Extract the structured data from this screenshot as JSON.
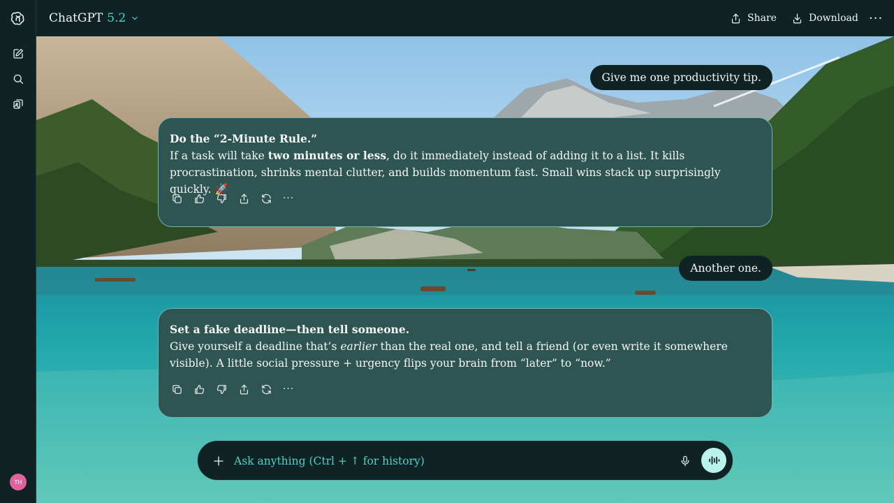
{
  "app": {
    "model_name": "ChatGPT",
    "model_version": "5.2"
  },
  "header": {
    "share_label": "Share",
    "download_label": "Download",
    "more_label": "···"
  },
  "sidebar": {
    "items": [
      {
        "icon": "openai-logo-icon"
      },
      {
        "icon": "new-chat-icon"
      },
      {
        "icon": "search-icon"
      },
      {
        "icon": "library-icon"
      }
    ],
    "avatar_initials": "TH"
  },
  "conversation": [
    {
      "role": "user",
      "text": "Give me one productivity tip."
    },
    {
      "role": "assistant",
      "title": "Do the “2-Minute Rule.”",
      "body_pre": "If a task will take ",
      "body_bold": "two minutes or less",
      "body_post": ", do it immediately instead of adding it to a list. It kills procrastination, shrinks mental clutter, and builds momentum fast. Small wins stack up surprisingly quickly. 🚀"
    },
    {
      "role": "user",
      "text": "Another one."
    },
    {
      "role": "assistant",
      "title": "Set a fake deadline—then tell someone.",
      "body_pre": "Give yourself a deadline that’s ",
      "body_italic": "earlier",
      "body_post": " than the real one, and tell a friend (or even write it somewhere visible). A little social pressure + urgency flips your brain from “later” to “now.”"
    }
  ],
  "message_actions": [
    "copy-icon",
    "thumbs-up-icon",
    "thumbs-down-icon",
    "share-icon",
    "regenerate-icon",
    "more-icon"
  ],
  "message_actions_more_label": "···",
  "composer": {
    "placeholder": "Ask anything (Ctrl + ↑ for history)",
    "value": ""
  },
  "colors": {
    "chrome": "#0f2324",
    "accent": "#4fd1c5",
    "assistant_card": "#2f5553",
    "voice_button": "#b9f3ea",
    "avatar": "#e0629a"
  }
}
